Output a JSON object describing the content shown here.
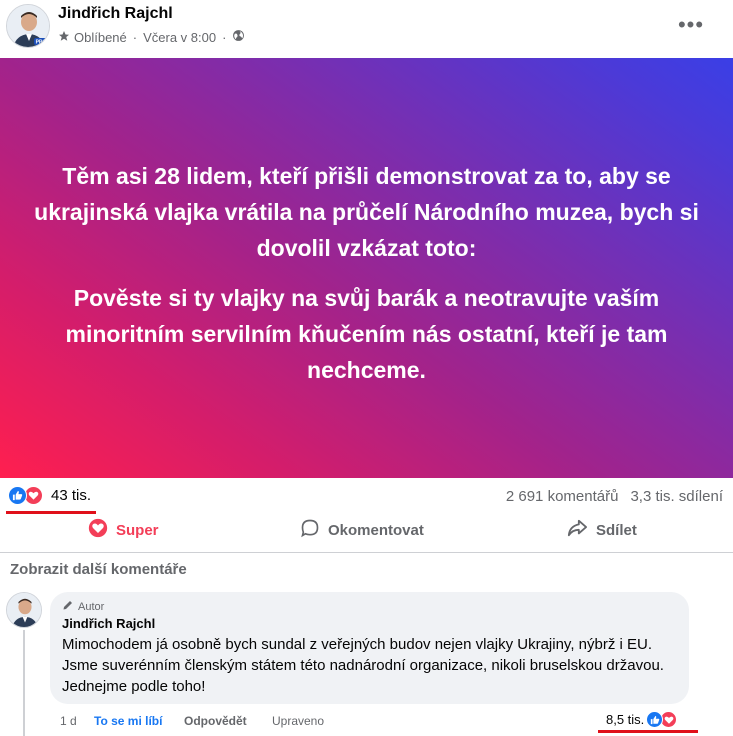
{
  "post": {
    "author": "Jindřich Rajchl",
    "favorite_label": "Oblíbené",
    "timestamp": "Včera v 8:00",
    "avatar_badge": "PRO",
    "more_label": "•••"
  },
  "banner": {
    "paragraph1": "Těm asi 28 lidem, kteří přišli demonstrovat za to, aby se ukrajinská vlajka vrátila na průčelí Národního muzea, bych si dovolil vzkázat toto:",
    "paragraph2": "Pověste si ty vlajky na svůj barák a neotravujte vaším minoritním servilním kňučením nás ostatní, kteří je tam nechceme.",
    "gradient_colors": [
      "#ff1f4f",
      "#a1238c",
      "#3a3fe6"
    ]
  },
  "stats": {
    "reactions_count": "43 tis.",
    "comments": "2 691 komentářů",
    "shares": "3,3 tis. sdílení"
  },
  "actions": {
    "super": "Super",
    "comment": "Okomentovat",
    "share": "Sdílet"
  },
  "comments": {
    "more_label": "Zobrazit další komentáře",
    "items": [
      {
        "author_badge": "Autor",
        "author": "Jindřich Rajchl",
        "text": "Mimochodem já osobně bych sundal z veřejných budov nejen vlajky Ukrajiny,  nýbrž i EU. Jsme suverénním členským státem této nadnárodní organizace, nikoli bruselskou državou. Jednejme podle toho!",
        "time": "1 d",
        "like_label": "To se mi líbí",
        "reply_label": "Odpovědět",
        "edited_label": "Upraveno",
        "reactions_count": "8,5 tis."
      }
    ]
  },
  "colors": {
    "facebook_blue": "#1877f2",
    "love_red": "#f33e58",
    "highlight_underline": "#e0101a",
    "secondary_text": "#65676b"
  }
}
